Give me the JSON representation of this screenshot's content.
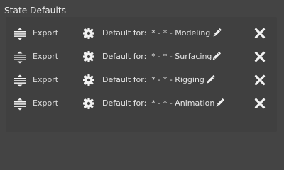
{
  "group": {
    "title": "State Defaults"
  },
  "states": [
    {
      "export_label": "Export",
      "name": "Default for:  * - * - Modeling"
    },
    {
      "export_label": "Export",
      "name": "Default for:  * - * - Surfacing"
    },
    {
      "export_label": "Export",
      "name": "Default for:  * - * - Rigging"
    },
    {
      "export_label": "Export",
      "name": "Default for:  * - * - Animation"
    }
  ],
  "icons": {
    "drag": "drag-handle-icon",
    "settings": "gear-icon",
    "edit": "pencil-icon",
    "remove": "close-icon"
  },
  "colors": {
    "background": "#444444",
    "group_background": "#404040",
    "text": "#e6e6e6",
    "icon": "#f2f2f2"
  }
}
